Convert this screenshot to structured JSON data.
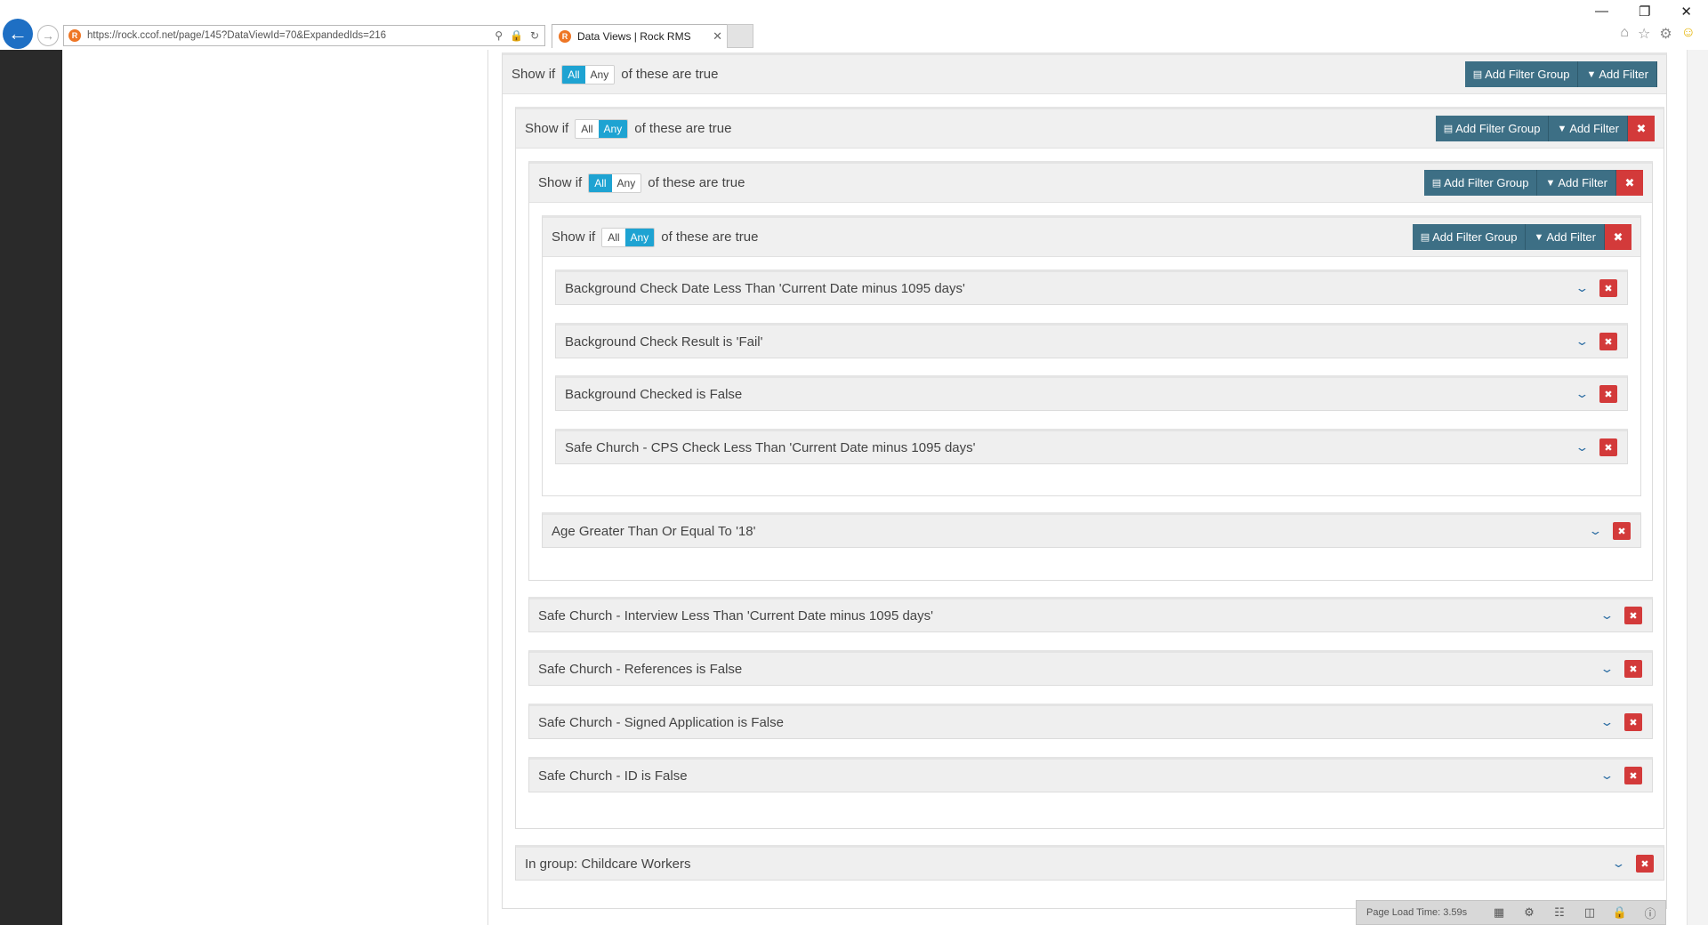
{
  "browser": {
    "url": "https://rock.ccof.net/page/145?DataViewId=70&ExpandedIds=216",
    "tab_title": "Data Views | Rock RMS",
    "window_controls": [
      "—",
      "❐",
      "✕"
    ]
  },
  "filters": {
    "show_if": "Show if",
    "of_these": "of these are true",
    "all": "All",
    "any": "Any",
    "add_filter_group": "Add Filter Group",
    "add_filter": "Add Filter",
    "root_mode": "All",
    "level1_mode": "Any",
    "level2_mode": "All",
    "level3_mode": "Any",
    "level3_rows": [
      "Background Check Date Less Than 'Current Date minus 1095 days'",
      "Background Check Result is 'Fail'",
      "Background Checked is False",
      "Safe Church - CPS Check Less Than 'Current Date minus 1095 days'"
    ],
    "level2_rows": [
      "Age Greater Than Or Equal To '18'"
    ],
    "level1_rows": [
      "Safe Church - Interview Less Than 'Current Date minus 1095 days'",
      "Safe Church - References is False",
      "Safe Church - Signed Application is False",
      "Safe Church - ID is False"
    ],
    "root_rows": [
      "In group: Childcare Workers"
    ]
  },
  "footer": {
    "load_time": "Page Load Time: 3.59s"
  },
  "colors": {
    "accent": "#1ea3d2",
    "button": "#3d6f85",
    "danger": "#d33a3a"
  }
}
